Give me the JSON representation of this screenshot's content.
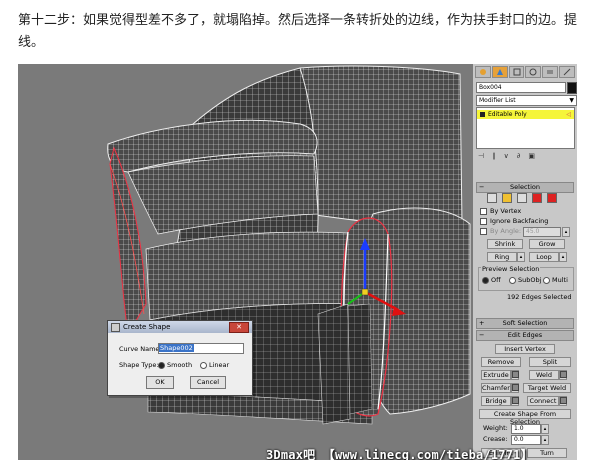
{
  "caption": "第十二步：如果觉得型差不多了，就塌陷掉。然后选择一条转折处的边线，作为扶手封口的边。提线。",
  "viewport": {
    "background": "#7a7a7a"
  },
  "command_panel": {
    "tabs": [
      "create-icon",
      "modify-icon",
      "hierarchy-icon",
      "motion-icon",
      "display-icon",
      "utilities-icon"
    ],
    "object_name": "Box004",
    "object_color": "#111111",
    "modifier_list_label": "Modifier List",
    "stack_item": "Editable Poly",
    "selection_rollout": "Selection",
    "by_vertex": "By Vertex",
    "ignore_backfacing": "Ignore Backfacing",
    "by_angle": "By Angle:",
    "by_angle_value": "45.0",
    "shrink": "Shrink",
    "grow": "Grow",
    "ring": "Ring",
    "loop": "Loop",
    "preview_selection": "Preview Selection",
    "preview_off": "Off",
    "preview_subobj": "SubObj",
    "preview_multi": "Multi",
    "selection_status": "192 Edges Selected",
    "soft_selection": "Soft Selection",
    "edit_edges": "Edit Edges",
    "insert_vertex": "Insert Vertex",
    "remove": "Remove",
    "split": "Split",
    "extrude": "Extrude",
    "weld": "Weld",
    "chamfer": "Chamfer",
    "target_weld": "Target Weld",
    "bridge": "Bridge",
    "connect": "Connect",
    "create_shape": "Create Shape From Selection",
    "weight_label": "Weight:",
    "weight_value": "1.0",
    "crease_label": "Crease:",
    "crease_value": "0.0",
    "edit_tri": "Edit Tri.",
    "turn": "Turn"
  },
  "dialog": {
    "title": "Create Shape",
    "curve_name_label": "Curve Name:",
    "curve_name_value": "Shape002",
    "shape_type_label": "Shape Type:",
    "smooth": "Smooth",
    "linear": "Linear",
    "ok": "OK",
    "cancel": "Cancel"
  },
  "watermark": "3Dmax吧 【www.linecg.com/tieba/1771】"
}
